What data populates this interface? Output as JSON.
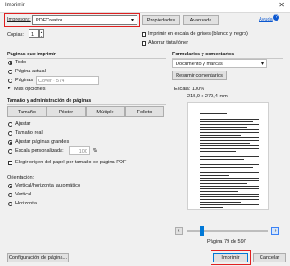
{
  "window": {
    "title": "Imprimir",
    "close_glyph": "✕"
  },
  "printer": {
    "label": "Impresora:",
    "value": "PDFCreator",
    "properties": "Propiedades",
    "advanced": "Avanzada",
    "help": "Ayuda"
  },
  "copies": {
    "label": "Copias:",
    "value": "1"
  },
  "options": {
    "grayscale": "Imprimir en escala de grises (blanco y negro)",
    "save_ink": "Ahorrar tinta/tóner"
  },
  "pages": {
    "title": "Páginas que imprimir",
    "all": "Todo",
    "current": "Página actual",
    "pages": "Páginas",
    "pages_placeholder": "Cover - 574",
    "more": "Más opciones"
  },
  "size": {
    "title": "Tamaño y administración de páginas",
    "tabs": [
      "Tamaño",
      "Póster",
      "Múltiple",
      "Folleto"
    ],
    "fit": "Ajustar",
    "actual": "Tamaño real",
    "shrink": "Ajustar páginas grandes",
    "custom": "Escala personalizada:",
    "custom_value": "100",
    "percent": "%",
    "paper_source": "Elegir origen del papel por tamaño de página PDF"
  },
  "orientation": {
    "title": "Orientación:",
    "auto": "Vertical/horizontal automático",
    "portrait": "Vertical",
    "landscape": "Horizontal"
  },
  "comments": {
    "title": "Formularios y comentarios",
    "select": "Documento y marcas",
    "summarize": "Resumir comentarios"
  },
  "preview": {
    "scale": "Escala: 100%",
    "dimensions": "215,9 x 279,4 mm",
    "page_label": "Página 79 de 597",
    "prev": "‹",
    "next": "›"
  },
  "footer": {
    "page_setup": "Configuración de página...",
    "print": "Imprimir",
    "cancel": "Cancelar"
  }
}
